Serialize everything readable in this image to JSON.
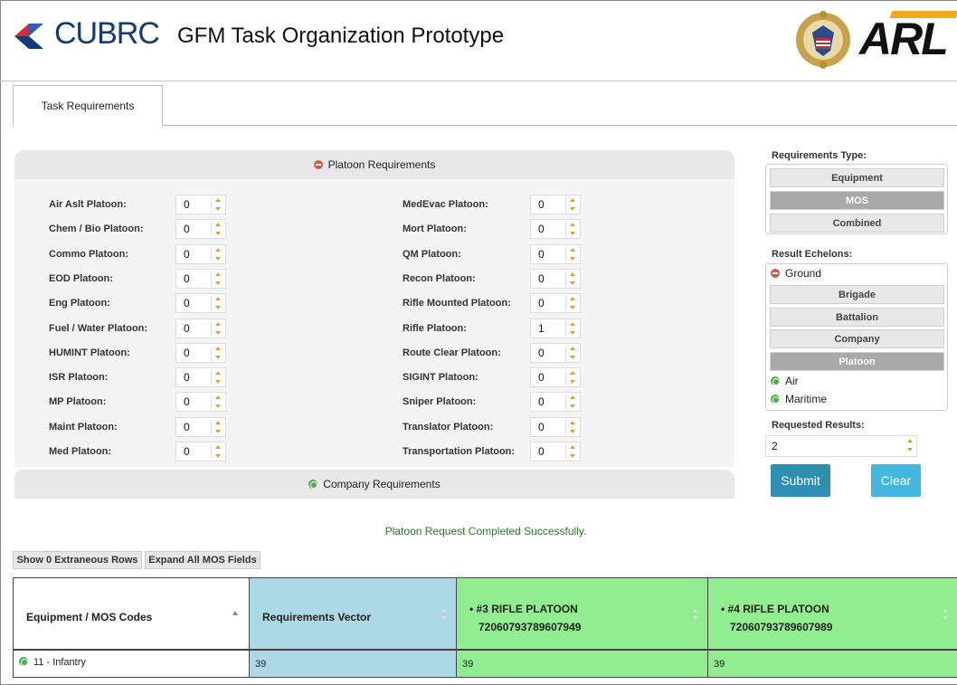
{
  "header": {
    "brand": "CUBRC",
    "app_title": "GFM Task Organization Prototype",
    "partner_logo": "ARL"
  },
  "tabs": [
    {
      "label": "Task Requirements"
    }
  ],
  "platoon_panel": {
    "title": "Platoon Requirements",
    "left": [
      {
        "label": "Air Aslt Platoon:",
        "value": "0"
      },
      {
        "label": "Chem / Bio Platoon:",
        "value": "0"
      },
      {
        "label": "Commo Platoon:",
        "value": "0"
      },
      {
        "label": "EOD Platoon:",
        "value": "0"
      },
      {
        "label": "Eng Platoon:",
        "value": "0"
      },
      {
        "label": "Fuel / Water Platoon:",
        "value": "0"
      },
      {
        "label": "HUMINT Platoon:",
        "value": "0"
      },
      {
        "label": "ISR Platoon:",
        "value": "0"
      },
      {
        "label": "MP Platoon:",
        "value": "0"
      },
      {
        "label": "Maint Platoon:",
        "value": "0"
      },
      {
        "label": "Med Platoon:",
        "value": "0"
      }
    ],
    "right": [
      {
        "label": "MedEvac Platoon:",
        "value": "0"
      },
      {
        "label": "Mort Platoon:",
        "value": "0"
      },
      {
        "label": "QM Platoon:",
        "value": "0"
      },
      {
        "label": "Recon Platoon:",
        "value": "0"
      },
      {
        "label": "Rifle Mounted Platoon:",
        "value": "0"
      },
      {
        "label": "Rifle Platoon:",
        "value": "1"
      },
      {
        "label": "Route Clear Platoon:",
        "value": "0"
      },
      {
        "label": "SIGINT Platoon:",
        "value": "0"
      },
      {
        "label": "Sniper Platoon:",
        "value": "0"
      },
      {
        "label": "Translator Platoon:",
        "value": "0"
      },
      {
        "label": "Transportation Platoon:",
        "value": "0"
      }
    ]
  },
  "company_panel": {
    "title": "Company Requirements"
  },
  "sidebar": {
    "requirements_type_label": "Requirements Type:",
    "requirements_types": [
      "Equipment",
      "MOS",
      "Combined"
    ],
    "requirements_type_selected": "MOS",
    "result_echelons_label": "Result Echelons:",
    "ground_label": "Ground",
    "ground_children": [
      "Brigade",
      "Battalion",
      "Company",
      "Platoon"
    ],
    "ground_selected": "Platoon",
    "air_label": "Air",
    "maritime_label": "Maritime",
    "requested_results_label": "Requested Results:",
    "requested_results_value": "2",
    "submit_label": "Submit",
    "clear_label": "Clear"
  },
  "status_message": "Platoon Request Completed Successfully.",
  "table_controls": {
    "show_extraneous": "Show 0 Extraneous Rows",
    "expand_mos": "Expand All MOS Fields"
  },
  "table": {
    "headers": {
      "codes": "Equipment / MOS Codes",
      "vector": "Requirements Vector",
      "col3_name": "• #3 RIFLE PLATOON",
      "col3_id": "72060793789607949",
      "col4_name": "• #4 RIFLE PLATOON",
      "col4_id": "72060793789607989"
    },
    "rows": [
      {
        "code": "11 - Infantry",
        "vector": "39",
        "col3": "39",
        "col4": "39"
      }
    ]
  },
  "colors": {
    "brand_blue": "#123b73",
    "submit": "#2f8fb0",
    "clear": "#45b6dd",
    "unit_green": "#90ee90",
    "vector_blue": "#add8e6",
    "success_text": "#2a7a2a"
  }
}
